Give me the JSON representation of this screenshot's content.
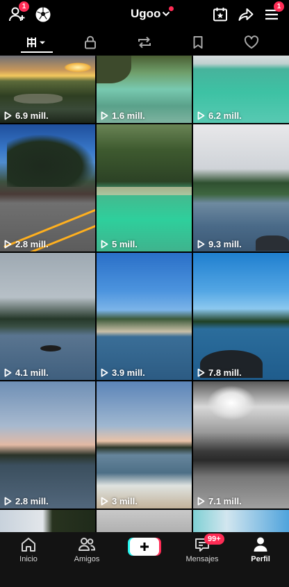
{
  "header": {
    "username": "Ugoo",
    "follow_requests_count": "1",
    "menu_badge_count": "1",
    "icons": [
      "add-friend-icon",
      "soccer-ball-icon",
      "chevron-down-icon",
      "calendar-star-icon",
      "share-arrow-icon",
      "hamburger-menu-icon"
    ]
  },
  "tabs": [
    {
      "name": "videos",
      "icon": "grid-bars-icon",
      "active": true
    },
    {
      "name": "private",
      "icon": "lock-icon"
    },
    {
      "name": "reposts",
      "icon": "repost-icon"
    },
    {
      "name": "saved",
      "icon": "bookmark-icon"
    },
    {
      "name": "liked",
      "icon": "heart-icon"
    }
  ],
  "videos": [
    {
      "views": "6.9 mill."
    },
    {
      "views": "1.6 mill."
    },
    {
      "views": "6.2 mill."
    },
    {
      "views": "2.8 mill."
    },
    {
      "views": "5 mill."
    },
    {
      "views": "9.3 mill."
    },
    {
      "views": "4.1 mill."
    },
    {
      "views": "3.9 mill."
    },
    {
      "views": "7.8 mill."
    },
    {
      "views": "2.8 mill."
    },
    {
      "views": "3 mill."
    },
    {
      "views": "7.1 mill."
    }
  ],
  "bottom_nav": {
    "home": "Inicio",
    "friends": "Amigos",
    "messages": "Mensajes",
    "messages_badge": "99+",
    "profile": "Perfil"
  },
  "colors": {
    "accent": "#fe2c55",
    "cyan": "#25f4ee",
    "background": "#000000"
  }
}
